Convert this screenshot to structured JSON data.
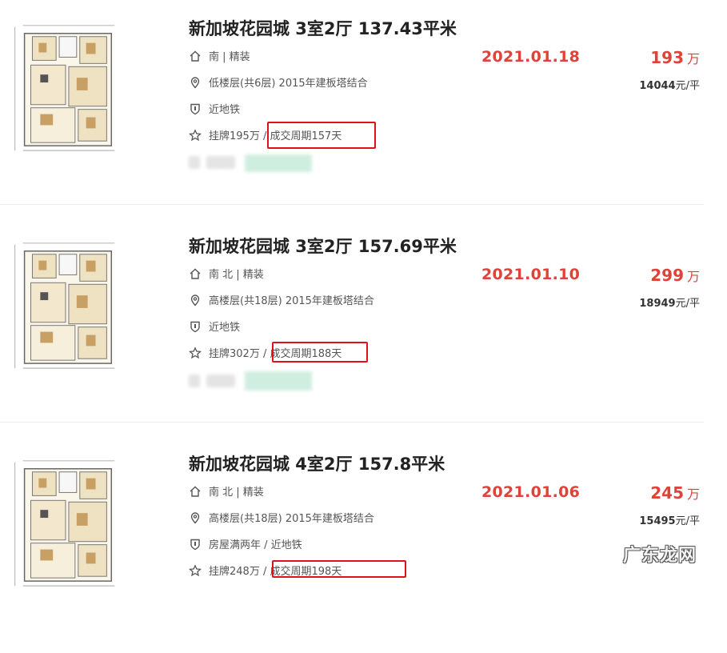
{
  "currency_unit": "万",
  "listings": [
    {
      "title": "新加坡花园城 3室2厅 137.43平米",
      "orientation": "南 | 精装",
      "floor_info": "低楼层(共6层) 2015年建板塔结合",
      "tags": "近地铁",
      "listing_price": "挂牌195万 /",
      "deal_cycle": "成交周期157天",
      "deal_date": "2021.01.18",
      "total_price": "193",
      "unit_price_value": "14044",
      "unit_price_suffix": "元/平"
    },
    {
      "title": "新加坡花园城 3室2厅 157.69平米",
      "orientation": "南 北 | 精装",
      "floor_info": "高楼层(共18层) 2015年建板塔结合",
      "tags": "近地铁",
      "listing_price": "挂牌302万 /",
      "deal_cycle": "成交周期188天",
      "deal_date": "2021.01.10",
      "total_price": "299",
      "unit_price_value": "18949",
      "unit_price_suffix": "元/平"
    },
    {
      "title": "新加坡花园城 4室2厅 157.8平米",
      "orientation": "南 北 | 精装",
      "floor_info": "高楼层(共18层) 2015年建板塔结合",
      "tags": "房屋满两年 / 近地铁",
      "listing_price": "挂牌248万 /",
      "deal_cycle": "成交周期198天",
      "deal_date": "2021.01.06",
      "total_price": "245",
      "unit_price_value": "15495",
      "unit_price_suffix": "元/平"
    }
  ],
  "icons": {
    "orientation": "house-icon",
    "floor": "location-pin-icon",
    "tags": "shield-icon",
    "listing": "star-icon"
  },
  "colors": {
    "accent_red": "#e0423a",
    "highlight_box": "#e0101a",
    "text": "#555555"
  },
  "watermark": "广东龙网"
}
